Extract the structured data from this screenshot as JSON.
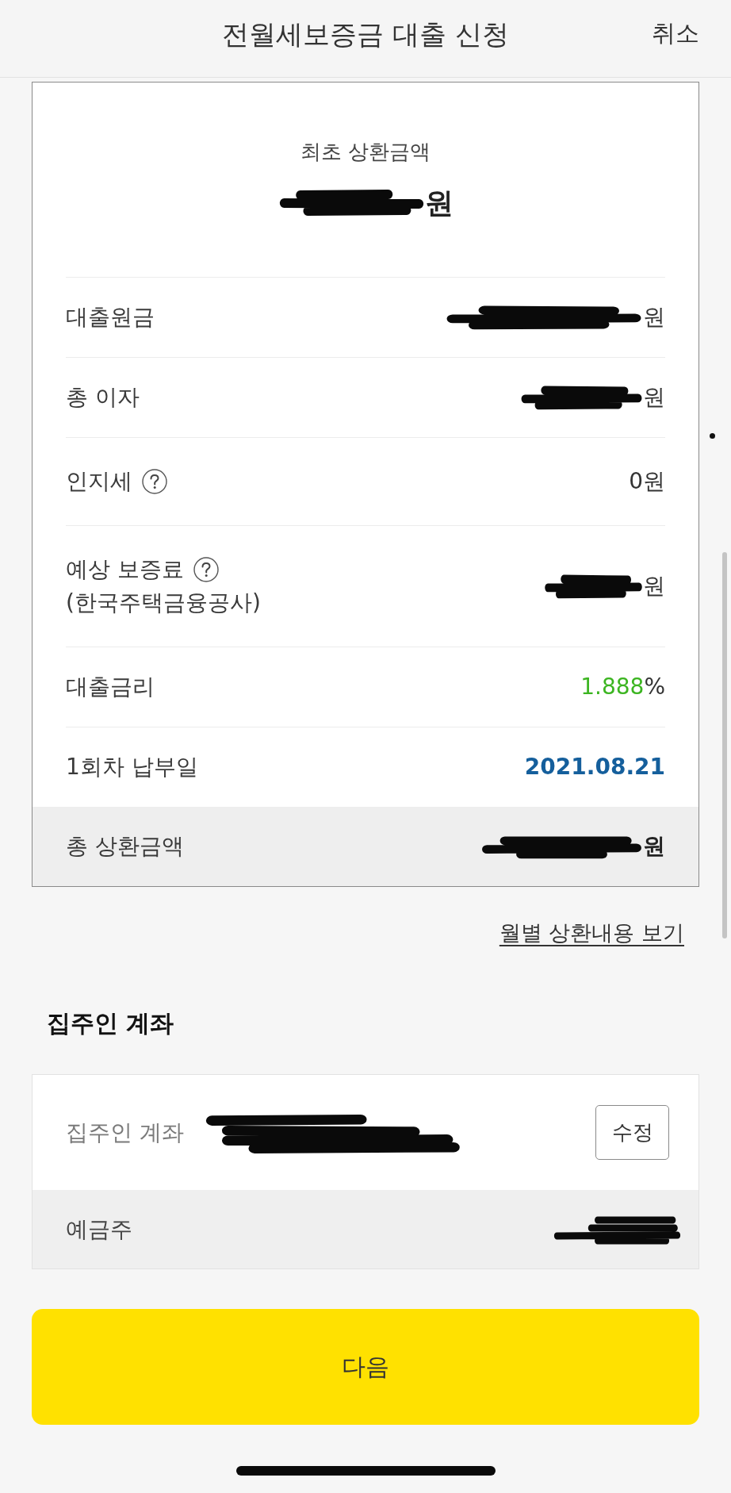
{
  "header": {
    "title": "전월세보증금 대출 신청",
    "cancel": "취소"
  },
  "summary": {
    "label": "최초 상환금액",
    "value": "원",
    "redacted": true
  },
  "details": [
    {
      "label": "대출원금",
      "help": false,
      "kind": "amount",
      "value": "원",
      "redacted": true
    },
    {
      "label": "총 이자",
      "help": false,
      "kind": "amount",
      "value": "원",
      "redacted": true
    },
    {
      "label": "인지세",
      "help": true,
      "kind": "amount",
      "value": "0원",
      "redacted": false
    },
    {
      "label": "예상 보증료",
      "sublabel": "(한국주택금융공사)",
      "help": true,
      "kind": "amount",
      "value": "원",
      "redacted": true
    },
    {
      "label": "대출금리",
      "help": false,
      "kind": "rate",
      "value": "1.888",
      "unit": "%",
      "redacted": false
    },
    {
      "label": "1회차 납부일",
      "help": false,
      "kind": "date",
      "value": "2021.08.21",
      "redacted": false
    }
  ],
  "total": {
    "label": "총 상환금액",
    "value": "원",
    "redacted": true
  },
  "schedule_link": "월별 상환내용 보기",
  "landlord_account": {
    "heading": "집주인 계좌",
    "rows": [
      {
        "kind": "account",
        "label": "집주인 계좌",
        "redacted": true,
        "button": "수정"
      },
      {
        "kind": "holder",
        "label": "예금주",
        "redacted": true
      }
    ]
  },
  "next_button": "다음"
}
